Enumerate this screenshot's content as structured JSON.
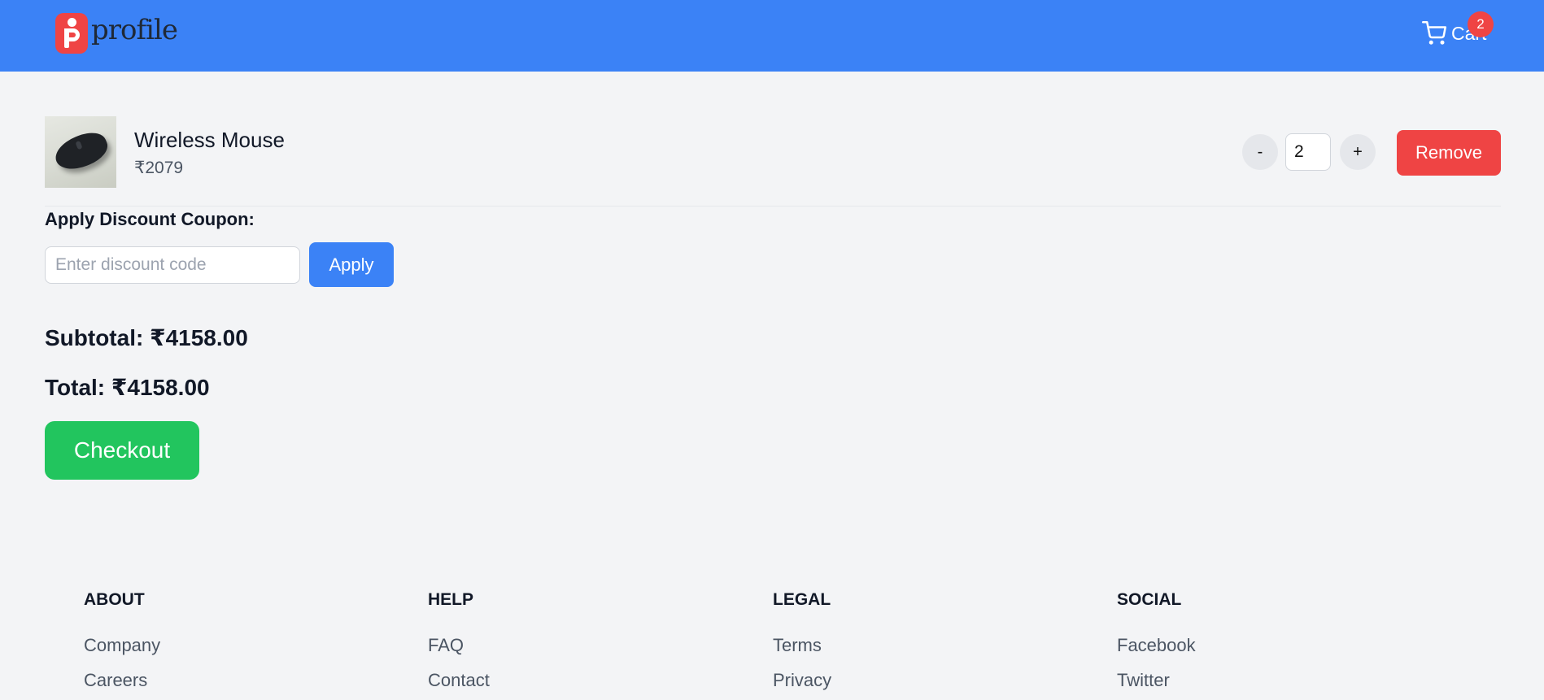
{
  "header": {
    "logo_text": "profile",
    "cart_label": "Cart",
    "cart_count": "2",
    "bg_color": "#3b82f6"
  },
  "cart_items": [
    {
      "name": "Wireless Mouse",
      "price": "₹2079",
      "quantity": "2",
      "minus_label": "-",
      "plus_label": "+",
      "remove_label": "Remove"
    }
  ],
  "coupon": {
    "label": "Apply Discount Coupon:",
    "placeholder": "Enter discount code",
    "value": "",
    "apply_label": "Apply"
  },
  "summary": {
    "subtotal": "Subtotal: ₹4158.00",
    "total": "Total: ₹4158.00",
    "checkout_label": "Checkout"
  },
  "footer": {
    "columns": [
      {
        "title": "ABOUT",
        "links": [
          "Company",
          "Careers"
        ]
      },
      {
        "title": "HELP",
        "links": [
          "FAQ",
          "Contact"
        ]
      },
      {
        "title": "LEGAL",
        "links": [
          "Terms",
          "Privacy"
        ]
      },
      {
        "title": "SOCIAL",
        "links": [
          "Facebook",
          "Twitter"
        ]
      }
    ]
  },
  "colors": {
    "accent": "#3b82f6",
    "danger": "#ef4444",
    "success": "#22c55e",
    "background": "#f3f4f6"
  }
}
